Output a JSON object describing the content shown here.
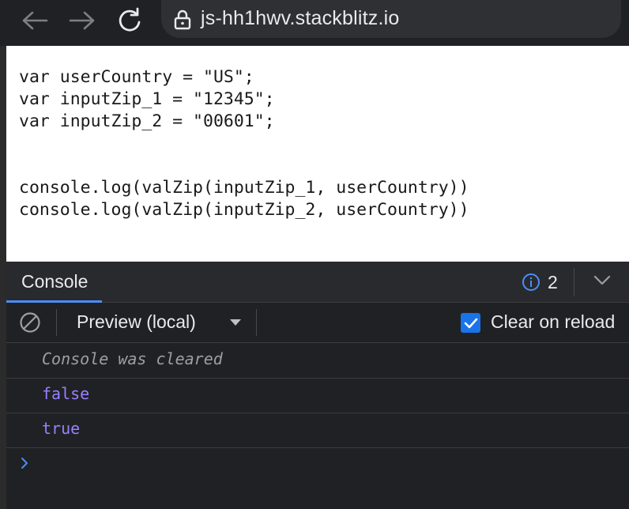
{
  "browser": {
    "url": "js-hh1hwv.stackblitz.io",
    "icons": [
      "back-arrow-icon",
      "forward-arrow-icon",
      "reload-icon",
      "lock-icon"
    ]
  },
  "editor": {
    "code_lines": [
      "var userCountry = \"US\";",
      "var inputZip_1 = \"12345\";",
      "var inputZip_2 = \"00601\";",
      "",
      "",
      "console.log(valZip(inputZip_1, userCountry))",
      "console.log(valZip(inputZip_2, userCountry))"
    ]
  },
  "devtools": {
    "tab_label": "Console",
    "issues_count": "2",
    "context_label": "Preview (local)",
    "clear_on_reload_label": "Clear on reload",
    "clear_on_reload_checked": true,
    "messages": [
      {
        "text": "Console was cleared",
        "kind": "info"
      },
      {
        "text": "false",
        "kind": "value"
      },
      {
        "text": "true",
        "kind": "value"
      }
    ],
    "prompt_icon": "chevron-right-icon"
  },
  "colors": {
    "accent": "#4c8df6",
    "checkbox": "#1a73e8",
    "value_text": "#9980ff",
    "muted_text": "#9aa0a6",
    "panel_bg": "#202124"
  }
}
